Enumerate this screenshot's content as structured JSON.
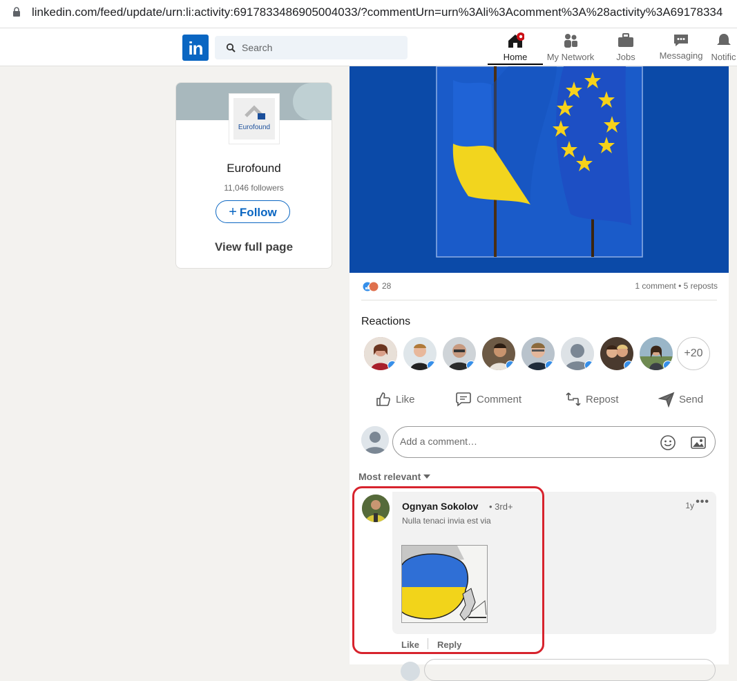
{
  "browser": {
    "url": "linkedin.com/feed/update/urn:li:activity:6917833486905004033/?commentUrn=urn%3Ali%3Acomment%3A%28activity%3A69178334"
  },
  "header": {
    "logo_text": "in",
    "search_placeholder": "Search",
    "nav": [
      {
        "label": "Home",
        "icon": "home-icon",
        "active": true,
        "has_notification": true
      },
      {
        "label": "My Network",
        "icon": "network-icon"
      },
      {
        "label": "Jobs",
        "icon": "briefcase-icon"
      },
      {
        "label": "Messaging",
        "icon": "messaging-icon"
      },
      {
        "label": "Notific",
        "icon": "bell-icon"
      }
    ]
  },
  "company_card": {
    "logo_text": "Eurofound",
    "name": "Eurofound",
    "followers": "11,046 followers",
    "follow_label": "Follow",
    "view_full_label": "View full page"
  },
  "post": {
    "reaction_count": "28",
    "comments_reposts": "1 comment • 5 reposts",
    "reactions_title": "Reactions",
    "reactors_more": "+20",
    "actions": {
      "like": "Like",
      "comment": "Comment",
      "repost": "Repost",
      "send": "Send"
    },
    "comment_placeholder": "Add a comment…",
    "sort_label": "Most relevant"
  },
  "comment": {
    "author": "Ognyan Sokolov",
    "degree": "• 3rd+",
    "headline": "Nulla tenaci invia est via",
    "time": "1y",
    "more": "•••",
    "like_label": "Like",
    "reply_label": "Reply"
  },
  "colors": {
    "brand": "#0a66c2",
    "highlight": "#d7232d",
    "background": "#f3f2ef"
  }
}
